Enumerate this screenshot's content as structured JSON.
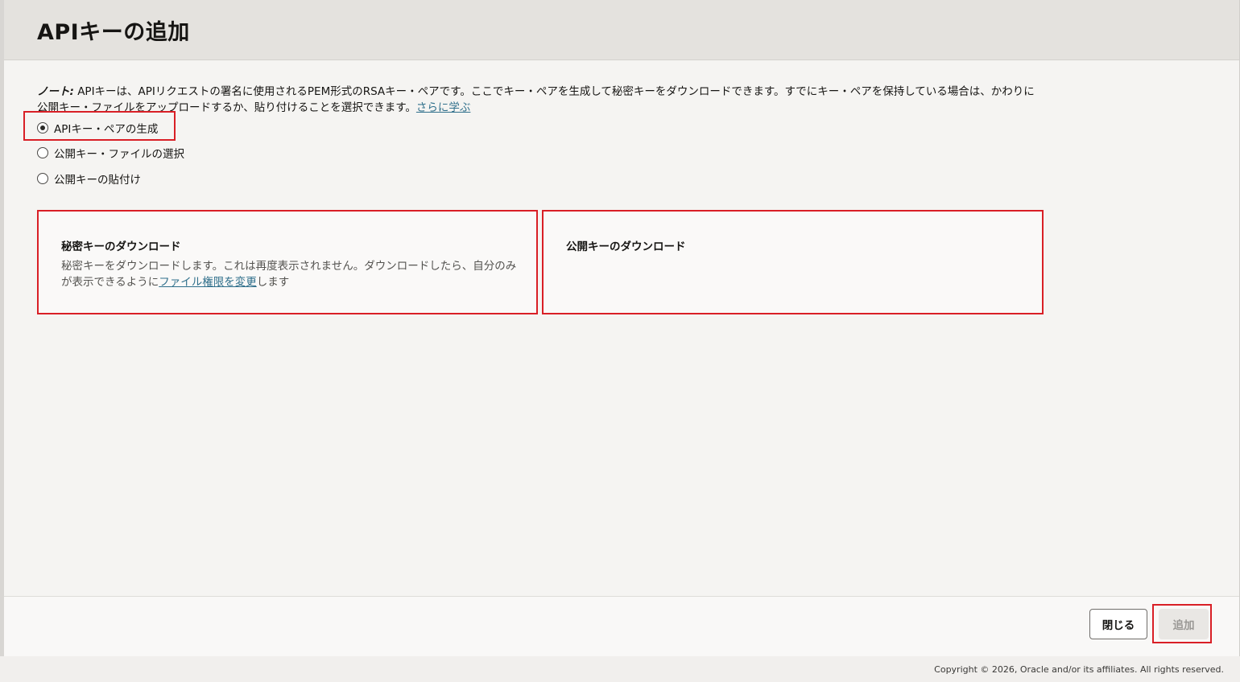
{
  "dialog": {
    "title": "APIキーの追加",
    "note_label": "ノート:",
    "note_text": " APIキーは、APIリクエストの署名に使用されるPEM形式のRSAキー・ペアです。ここでキー・ペアを生成して秘密キーをダウンロードできます。すでにキー・ペアを保持している場合は、かわりに公開キー・ファイルをアップロードするか、貼り付けることを選択できます。",
    "learn_more": "さらに学ぶ",
    "options": [
      {
        "label": "APIキー・ペアの生成",
        "selected": true
      },
      {
        "label": "公開キー・ファイルの選択",
        "selected": false
      },
      {
        "label": "公開キーの貼付け",
        "selected": false
      }
    ],
    "private_key": {
      "title": "秘密キーのダウンロード",
      "desc_before": "秘密キーをダウンロードします。これは再度表示されません。ダウンロードしたら、自分のみが表示できるように",
      "desc_link": "ファイル権限を変更",
      "desc_after": "します"
    },
    "public_key": {
      "title": "公開キーのダウンロード"
    },
    "buttons": {
      "close": "閉じる",
      "add": "追加"
    }
  },
  "footer": {
    "copyright": "Copyright © 2026, Oracle and/or its affiliates. All rights reserved."
  },
  "colors": {
    "highlight": "#d91f26",
    "link": "#2f6f8b"
  }
}
